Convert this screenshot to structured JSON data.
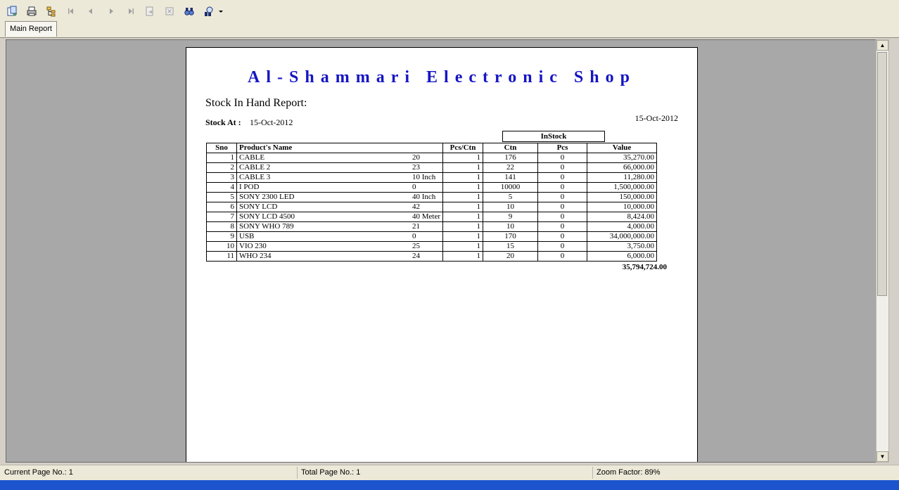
{
  "toolbar": {
    "buttons": [
      {
        "icon": "export-icon"
      },
      {
        "icon": "print-icon"
      },
      {
        "icon": "group-tree-icon"
      },
      {
        "icon": "first-page-icon"
      },
      {
        "icon": "previous-page-icon"
      },
      {
        "icon": "next-page-icon"
      },
      {
        "icon": "last-page-icon"
      },
      {
        "icon": "goto-page-icon"
      },
      {
        "icon": "close-current-view-icon"
      },
      {
        "icon": "search-text-icon"
      },
      {
        "icon": "zoom-icon"
      }
    ]
  },
  "tabs": [
    {
      "label": "Main Report"
    }
  ],
  "report": {
    "shop_name": "Al-Shammari Electronic Shop",
    "title": "Stock In Hand Report:",
    "stock_at_label": "Stock At :",
    "stock_at_value": "15-Oct-2012",
    "print_date": "15-Oct-2012",
    "instock_header": "InStock",
    "columns": {
      "sno": "Sno",
      "name": "Product's  Name",
      "pcs_ctn": "Pcs/Ctn",
      "ctn": "Ctn",
      "pcs": "Pcs",
      "value": "Value"
    },
    "rows": [
      {
        "sno": "1",
        "name": "CABLE",
        "size": "20",
        "pcs_ctn": "1",
        "ctn": "176",
        "pcs": "0",
        "value": "35,270.00"
      },
      {
        "sno": "2",
        "name": "CABLE 2",
        "size": "23",
        "pcs_ctn": "1",
        "ctn": "22",
        "pcs": "0",
        "value": "66,000.00"
      },
      {
        "sno": "3",
        "name": "CABLE 3",
        "size": "10 Inch",
        "pcs_ctn": "1",
        "ctn": "141",
        "pcs": "0",
        "value": "11,280.00"
      },
      {
        "sno": "4",
        "name": "I POD",
        "size": "0",
        "pcs_ctn": "1",
        "ctn": "10000",
        "pcs": "0",
        "value": "1,500,000.00"
      },
      {
        "sno": "5",
        "name": "SONY 2300 LED",
        "size": "40 Inch",
        "pcs_ctn": "1",
        "ctn": "5",
        "pcs": "0",
        "value": "150,000.00"
      },
      {
        "sno": "6",
        "name": "SONY LCD",
        "size": "42",
        "pcs_ctn": "1",
        "ctn": "10",
        "pcs": "0",
        "value": "10,000.00"
      },
      {
        "sno": "7",
        "name": "SONY LCD 4500",
        "size": "40 Meter",
        "pcs_ctn": "1",
        "ctn": "9",
        "pcs": "0",
        "value": "8,424.00"
      },
      {
        "sno": "8",
        "name": "SONY WHO 789",
        "size": "21",
        "pcs_ctn": "1",
        "ctn": "10",
        "pcs": "0",
        "value": "4,000.00"
      },
      {
        "sno": "9",
        "name": "USB",
        "size": "0",
        "pcs_ctn": "1",
        "ctn": "170",
        "pcs": "0",
        "value": "34,000,000.00"
      },
      {
        "sno": "10",
        "name": "VIO 230",
        "size": "25",
        "pcs_ctn": "1",
        "ctn": "15",
        "pcs": "0",
        "value": "3,750.00"
      },
      {
        "sno": "11",
        "name": "WHO 234",
        "size": "24",
        "pcs_ctn": "1",
        "ctn": "20",
        "pcs": "0",
        "value": "6,000.00"
      }
    ],
    "total": "35,794,724.00"
  },
  "status": {
    "current_page": "Current Page No.: 1",
    "total_page": "Total Page No.: 1",
    "zoom": "Zoom Factor: 89%"
  },
  "colors": {
    "shop_title": "#1515c4",
    "viewer_bg": "#a8a8a8",
    "chrome": "#ece9d8",
    "taskbar": "#1b54cc"
  }
}
